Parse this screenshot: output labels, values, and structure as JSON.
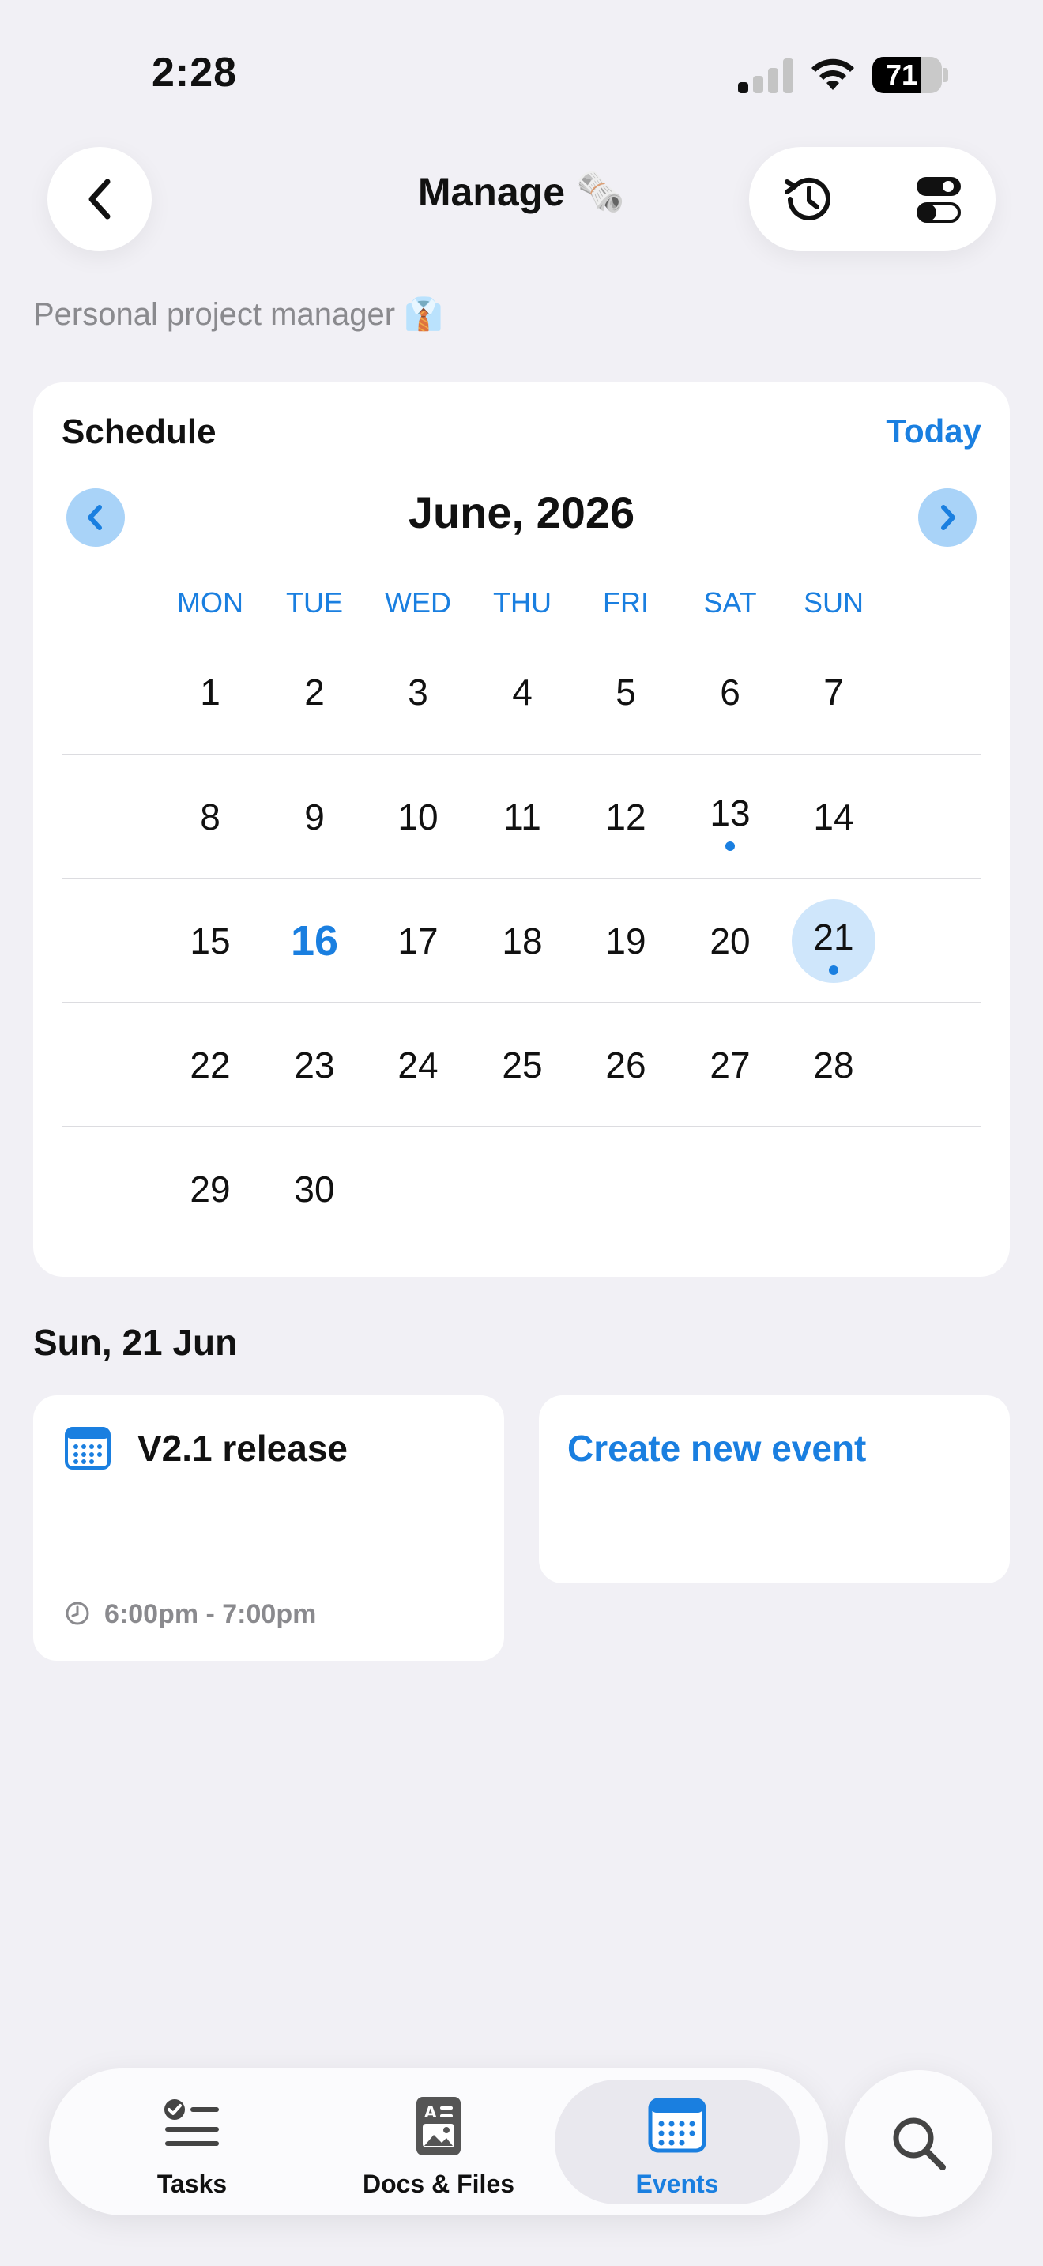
{
  "status_bar": {
    "time": "2:28",
    "battery": "71",
    "battery_level": 0.71
  },
  "header": {
    "title": "Manage 🗞️",
    "subtitle": "Personal project manager 👔"
  },
  "schedule": {
    "title": "Schedule",
    "today_label": "Today",
    "month_label": "June, 2026",
    "weekdays": [
      "MON",
      "TUE",
      "WED",
      "THU",
      "FRI",
      "SAT",
      "SUN"
    ],
    "weeks": [
      [
        "1",
        "2",
        "3",
        "4",
        "5",
        "6",
        "7"
      ],
      [
        "8",
        "9",
        "10",
        "11",
        "12",
        "13",
        "14"
      ],
      [
        "15",
        "16",
        "17",
        "18",
        "19",
        "20",
        "21"
      ],
      [
        "22",
        "23",
        "24",
        "25",
        "26",
        "27",
        "28"
      ],
      [
        "29",
        "30"
      ]
    ],
    "today_day": "16",
    "selected_day": "21",
    "days_with_events": [
      "13",
      "21"
    ]
  },
  "selected_date_heading": "Sun, 21 Jun",
  "events": [
    {
      "title": "V2.1 release",
      "time": "6:00pm - 7:00pm",
      "icon": "calendar-icon"
    }
  ],
  "create_event_label": "Create new event",
  "tabbar": {
    "tabs": [
      {
        "label": "Tasks",
        "icon": "tasks-icon",
        "active": false
      },
      {
        "label": "Docs & Files",
        "icon": "docs-icon",
        "active": false
      },
      {
        "label": "Events",
        "icon": "calendar-icon",
        "active": true
      }
    ]
  },
  "colors": {
    "accent": "#1a7fe0",
    "selected_bg": "#cfe6fb",
    "background": "#f1f0f5"
  }
}
